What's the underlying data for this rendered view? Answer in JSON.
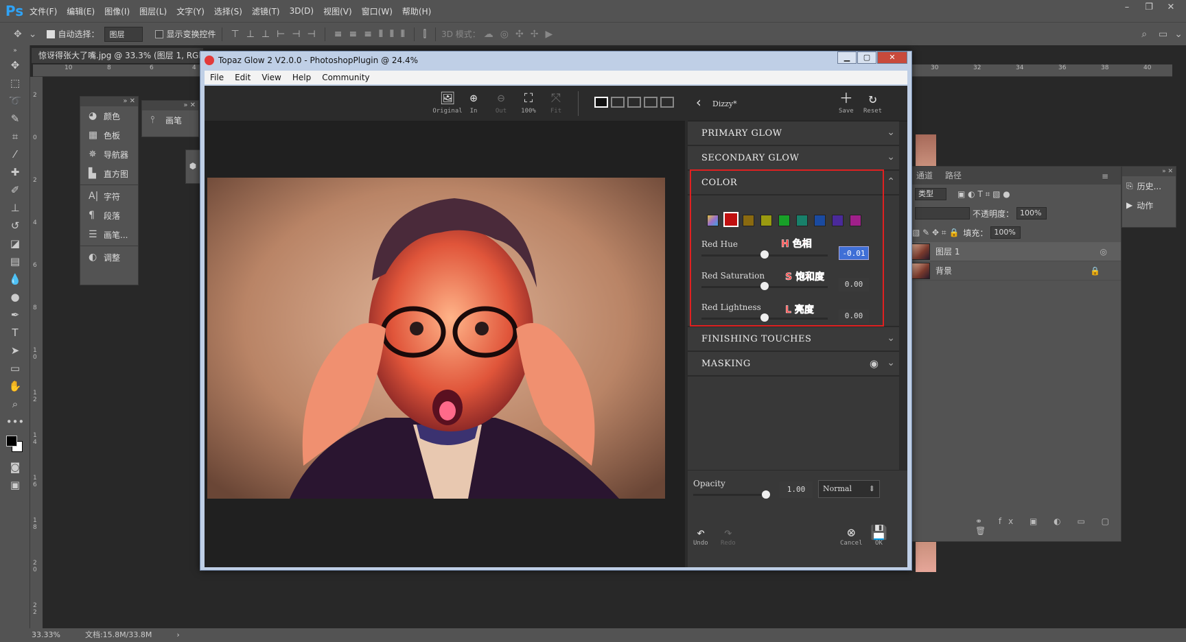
{
  "ps": {
    "logo": "Ps",
    "menus": [
      "文件(F)",
      "编辑(E)",
      "图像(I)",
      "图层(L)",
      "文字(Y)",
      "选择(S)",
      "滤镜(T)",
      "3D(D)",
      "视图(V)",
      "窗口(W)",
      "帮助(H)"
    ],
    "options": {
      "auto_select_label": "自动选择：",
      "auto_select_value": "图层",
      "show_transform_label": "显示变换控件",
      "mode_3d_label": "3D 模式："
    },
    "doc_tab": "惊讶得张大了嘴.jpg @ 33.3% (图层 1, RGB/",
    "ruler_h": [
      "10",
      "8",
      "6",
      "4",
      "30",
      "32",
      "34",
      "36",
      "38",
      "40"
    ],
    "ruler_v": [
      "2",
      "0",
      "2",
      "4",
      "6",
      "8",
      "1 0",
      "1 2",
      "1 4",
      "1 6",
      "1 8",
      "2 0",
      "2 2"
    ],
    "status": {
      "zoom": "33.33%",
      "doc": "文档:15.8M/33.8M"
    },
    "panels": {
      "mini1": [
        "颜色",
        "色板",
        "导航器",
        "直方图",
        "字符",
        "段落",
        "画笔...",
        "调整"
      ],
      "mini2": [
        "画笔"
      ],
      "layers_tabs": [
        "通道",
        "路径"
      ],
      "kind_label": "类型",
      "opacity_label": "不透明度：",
      "opacity_value": "100%",
      "fill_label": "填充：",
      "fill_value": "100%",
      "layers": [
        "图层 1",
        "背景"
      ],
      "history": [
        "历史...",
        "动作"
      ]
    }
  },
  "topaz": {
    "title": "Topaz Glow 2 V2.0.0 - PhotoshopPlugin @ 24.4%",
    "menu": [
      "File",
      "Edit",
      "View",
      "Help",
      "Community"
    ],
    "toolbar": [
      {
        "label": "Original",
        "icon": "image-icon"
      },
      {
        "label": "In",
        "icon": "zoom-in-icon"
      },
      {
        "label": "Out",
        "icon": "zoom-out-icon"
      },
      {
        "label": "100%",
        "icon": "fullscreen-icon"
      },
      {
        "label": "Fit",
        "icon": "fit-icon"
      }
    ],
    "preset_name": "Dizzy*",
    "save_label": "Save",
    "reset_label": "Reset",
    "sections": {
      "primary": "PRIMARY GLOW",
      "secondary": "SECONDARY GLOW",
      "color": "COLOR",
      "finishing": "FINISHING TOUCHES",
      "masking": "MASKING"
    },
    "swatch_colors": [
      "#9a6fc9",
      "#c01010",
      "#8a6a10",
      "#9a9a10",
      "#18a028",
      "#18806a",
      "#1a4aa0",
      "#4a2a9a",
      "#a0208a"
    ],
    "sliders": [
      {
        "label": "Red Hue",
        "value": "-0.01",
        "annotation": "H 色相",
        "level": 0.5
      },
      {
        "label": "Red Saturation",
        "value": "0.00",
        "annotation": "S 饱和度",
        "level": 0.5
      },
      {
        "label": "Red Lightness",
        "value": "0.00",
        "annotation": "L 亮度",
        "level": 0.5
      }
    ],
    "opacity_label": "Opacity",
    "opacity_value": "1.00",
    "blend_mode": "Normal",
    "undo_label": "Undo",
    "redo_label": "Redo",
    "cancel_label": "Cancel",
    "ok_label": "OK"
  }
}
